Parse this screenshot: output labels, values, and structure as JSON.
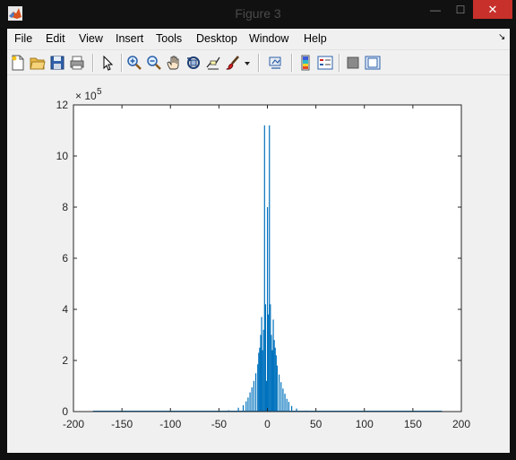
{
  "window": {
    "title": "Figure 3",
    "controls": {
      "minimize": "—",
      "maximize": "☐",
      "close": "✕"
    }
  },
  "menu": {
    "items": [
      "File",
      "Edit",
      "View",
      "Insert",
      "Tools",
      "Desktop",
      "Window",
      "Help"
    ],
    "dock_glyph": "↘"
  },
  "toolbar": {
    "buttons": [
      "new-figure-icon",
      "open-file-icon",
      "save-icon",
      "print-icon",
      "select-arrow-icon",
      "zoom-in-icon",
      "zoom-out-icon",
      "pan-hand-icon",
      "rotate-3d-icon",
      "data-cursor-icon",
      "brush-icon",
      "brush-dropdown-icon",
      "link-plot-icon",
      "colorbar-icon",
      "legend-icon",
      "hide-plot-tools-icon",
      "show-plot-tools-icon"
    ]
  },
  "colors": {
    "bar": "#0072bd",
    "axes_bg": "#ffffff",
    "figure_bg": "#f0f0f0",
    "close_button": "#c7302b"
  },
  "chart_data": {
    "type": "bar",
    "title": "",
    "xlabel": "",
    "ylabel": "",
    "xlim": [
      -200,
      200
    ],
    "ylim": [
      0,
      1200000
    ],
    "y_exponent_label": {
      "base": "× 10",
      "power": "5"
    },
    "xticks": [
      -200,
      -150,
      -100,
      -50,
      0,
      50,
      100,
      150,
      200
    ],
    "xtick_labels": [
      "-200",
      "-150",
      "-100",
      "-50",
      "0",
      "50",
      "100",
      "150",
      "200"
    ],
    "yticks": [
      0,
      200000,
      400000,
      600000,
      800000,
      1000000,
      1200000
    ],
    "ytick_labels": [
      "0",
      "2",
      "4",
      "6",
      "8",
      "10",
      "12"
    ],
    "bins": {
      "x": [
        -40,
        -30,
        -25,
        -22,
        -20,
        -18,
        -16,
        -14,
        -12,
        -10,
        -9,
        -8,
        -7,
        -6,
        -5,
        -4,
        -3,
        -2,
        -1,
        0,
        1,
        2,
        3,
        4,
        5,
        6,
        7,
        8,
        9,
        10,
        12,
        14,
        16,
        18,
        20,
        22,
        25,
        30,
        40
      ],
      "values": [
        5000,
        15000,
        25000,
        40000,
        55000,
        75000,
        95000,
        120000,
        150000,
        185000,
        230000,
        250000,
        300000,
        370000,
        240000,
        320000,
        1120000,
        420000,
        120000,
        800000,
        380000,
        1120000,
        420000,
        300000,
        240000,
        360000,
        280000,
        250000,
        220000,
        180000,
        145000,
        115000,
        90000,
        70000,
        50000,
        38000,
        22000,
        12000,
        4000
      ]
    },
    "grid": false,
    "legend": "none"
  }
}
